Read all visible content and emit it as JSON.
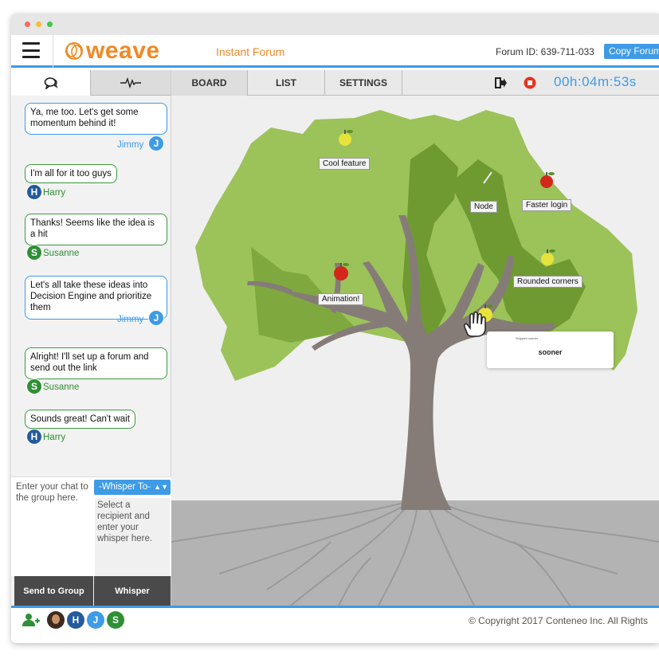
{
  "header": {
    "logo_text": "weave",
    "app_name": "Instant Forum",
    "forum_id": "Forum ID: 639-711-033",
    "copy_button": "Copy Forum"
  },
  "side_tabs": [
    {
      "icon": "chat-bubbles-icon"
    },
    {
      "icon": "activity-icon"
    }
  ],
  "chat": {
    "messages": [
      {
        "text": "Ya, me too. Let's get some momentum behind it!",
        "user": "Jimmy",
        "initial": "J"
      },
      {
        "text": "I'm all for it too guys",
        "user": "Harry",
        "initial": "H"
      },
      {
        "text": "Thanks! Seems like the idea is a hit",
        "user": "Susanne",
        "initial": "S"
      },
      {
        "text": "Let's all take these ideas into Decision Engine and prioritize them",
        "user": "Jimmy",
        "initial": "J"
      },
      {
        "text": "Alright! I'll set up a forum and send out the link",
        "user": "Susanne",
        "initial": "S"
      },
      {
        "text": "Sounds great! Can't wait",
        "user": "Harry",
        "initial": "H"
      }
    ],
    "compose_placeholder": "Enter your chat to the group here.",
    "whisper_select": "-Whisper To-",
    "whisper_placeholder": "Select a recipient and enter your whisper here.",
    "send_group_label": "Send to Group",
    "whisper_label": "Whisper"
  },
  "toolbar": {
    "tabs": [
      "BOARD",
      "LIST",
      "SETTINGS"
    ],
    "timer": "00h:04m:53s"
  },
  "board": {
    "ideas": [
      "Cool feature",
      "Node",
      "Faster login",
      "Rounded corners",
      "Animation!"
    ],
    "card_small_text": "Shipped sooner",
    "card_text": "sooner"
  },
  "footer": {
    "copyright": "© Copyright 2017 Conteneo Inc. All Rights",
    "participants": [
      "H",
      "J",
      "S"
    ]
  },
  "colors": {
    "accent_blue": "#3e9be6",
    "brand_orange": "#f08a24",
    "harry_blue": "#245b9c",
    "susanne_green": "#2f8f36",
    "record_red": "#e8321e"
  }
}
